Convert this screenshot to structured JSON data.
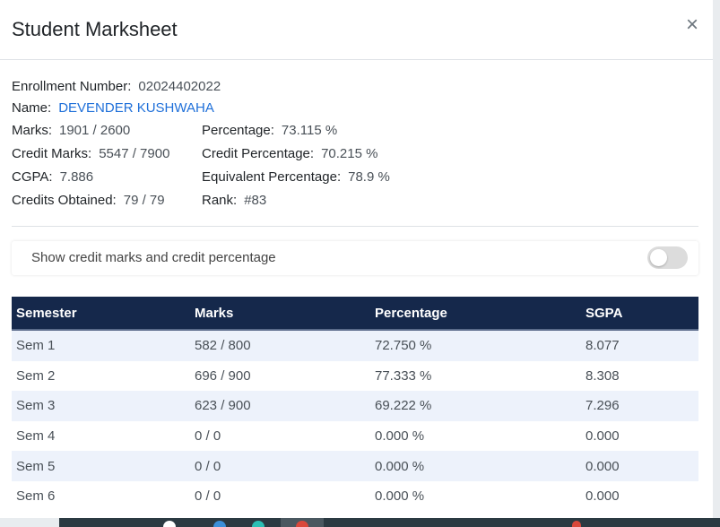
{
  "modal": {
    "title": "Student Marksheet",
    "close_symbol": "×"
  },
  "student": {
    "enrollment_label": "Enrollment Number:",
    "enrollment_value": "02024402022",
    "name_label": "Name:",
    "name_value": "DEVENDER KUSHWAHA",
    "marks_label": "Marks:",
    "marks_value": "1901 / 2600",
    "percentage_label": "Percentage:",
    "percentage_value": "73.115 %",
    "credit_marks_label": "Credit Marks:",
    "credit_marks_value": "5547 / 7900",
    "credit_percentage_label": "Credit Percentage:",
    "credit_percentage_value": "70.215 %",
    "cgpa_label": "CGPA:",
    "cgpa_value": "7.886",
    "equivalent_percentage_label": "Equivalent Percentage:",
    "equivalent_percentage_value": "78.9 %",
    "credits_obtained_label": "Credits Obtained:",
    "credits_obtained_value": "79 / 79",
    "rank_label": "Rank:",
    "rank_value": "#83"
  },
  "toggle": {
    "label": "Show credit marks and credit percentage",
    "on": false
  },
  "table": {
    "headers": [
      "Semester",
      "Marks",
      "Percentage",
      "SGPA"
    ],
    "rows": [
      [
        "Sem 1",
        "582 / 800",
        "72.750 %",
        "8.077"
      ],
      [
        "Sem 2",
        "696 / 900",
        "77.333 %",
        "8.308"
      ],
      [
        "Sem 3",
        "623 / 900",
        "69.222 %",
        "7.296"
      ],
      [
        "Sem 4",
        "0 / 0",
        "0.000 %",
        "0.000"
      ],
      [
        "Sem 5",
        "0 / 0",
        "0.000 %",
        "0.000"
      ],
      [
        "Sem 6",
        "0 / 0",
        "0.000 %",
        "0.000"
      ]
    ]
  },
  "colors": {
    "table_header_bg": "#15284b",
    "name_link": "#1e6fd9",
    "stripe": "#edf2fb"
  }
}
